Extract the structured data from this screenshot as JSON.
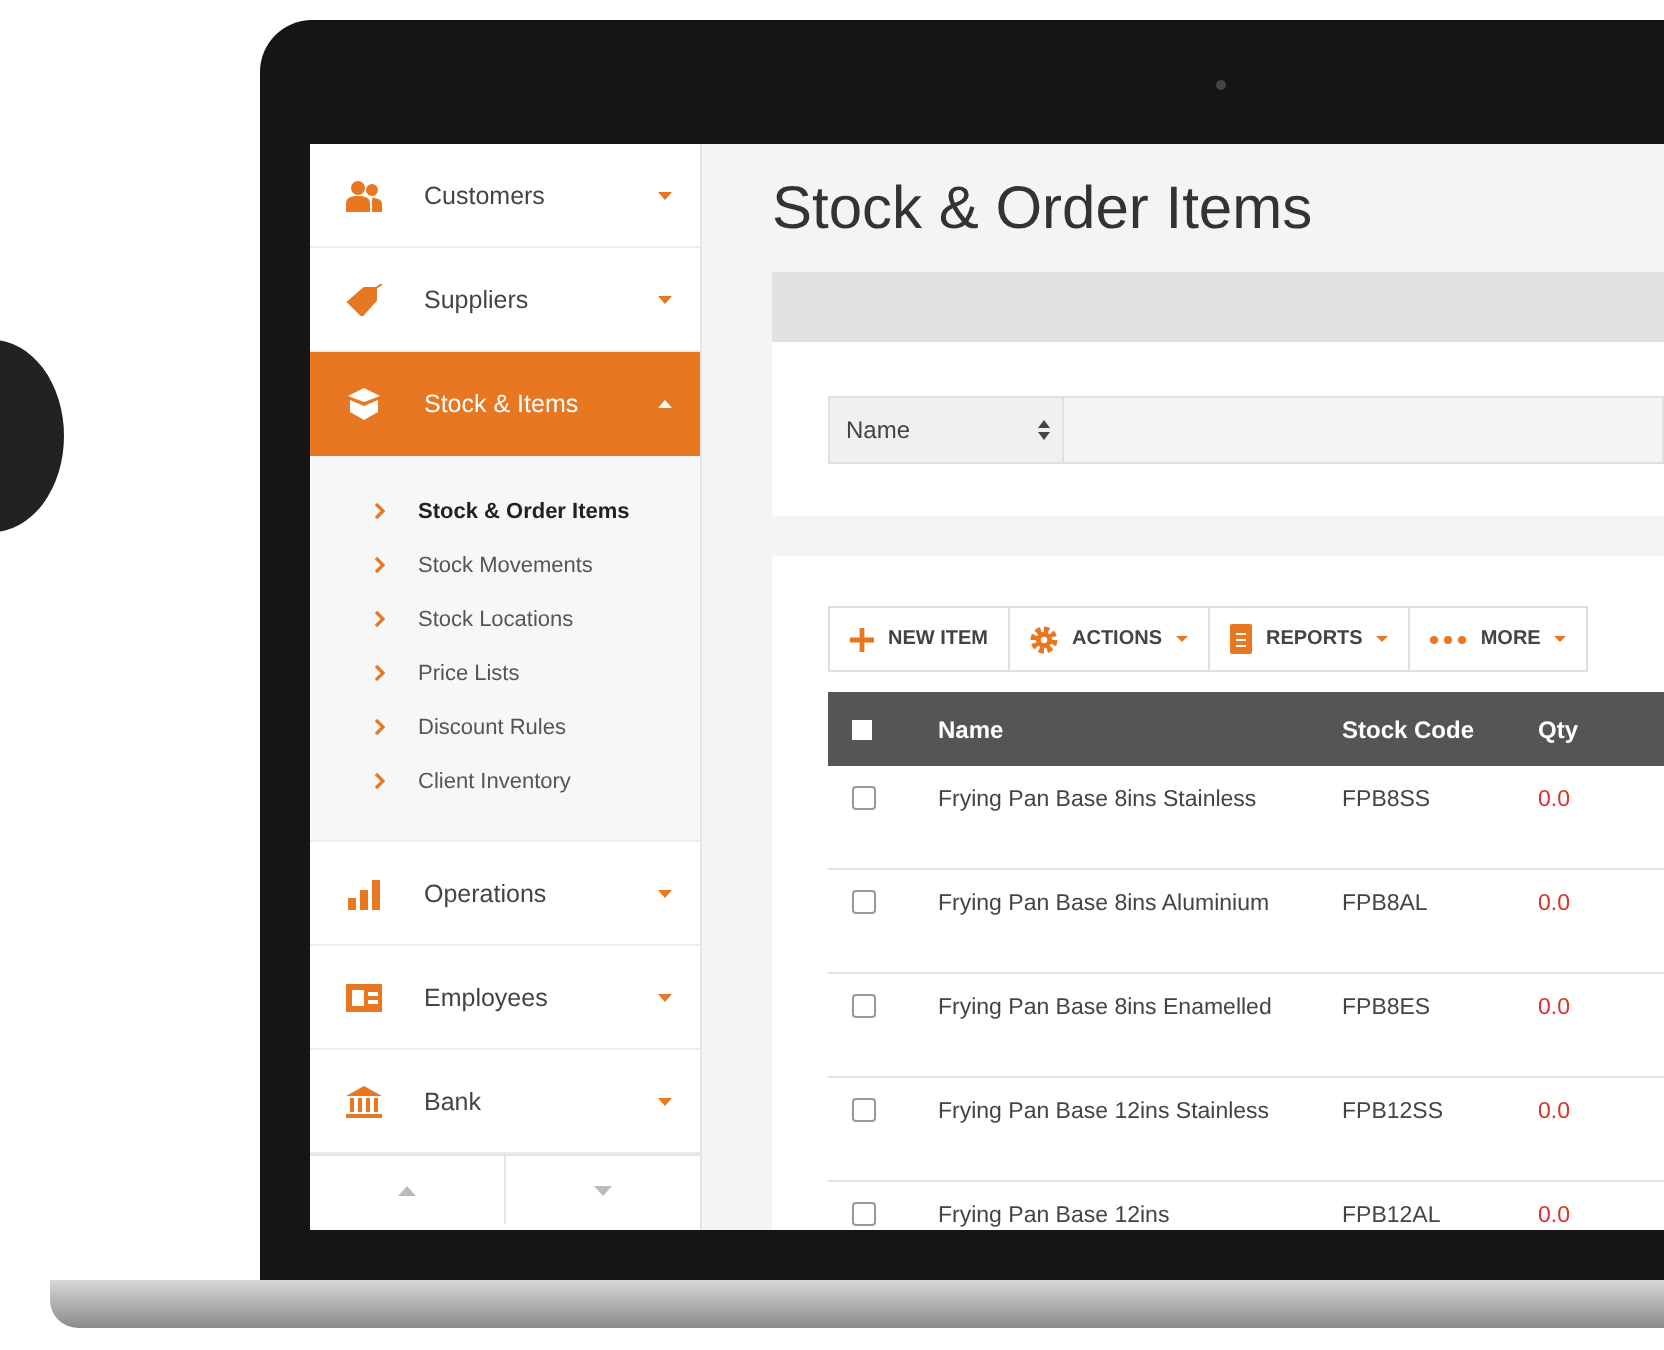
{
  "sidebar": {
    "items": [
      {
        "label": "Customers",
        "selected": false,
        "expanded": false
      },
      {
        "label": "Suppliers",
        "selected": false,
        "expanded": false
      },
      {
        "label": "Stock & Items",
        "selected": true,
        "expanded": true,
        "children": [
          {
            "label": "Stock & Order Items",
            "selected": true
          },
          {
            "label": "Stock Movements",
            "selected": false
          },
          {
            "label": "Stock Locations",
            "selected": false
          },
          {
            "label": "Price Lists",
            "selected": false
          },
          {
            "label": "Discount Rules",
            "selected": false
          },
          {
            "label": "Client Inventory",
            "selected": false
          }
        ]
      },
      {
        "label": "Operations",
        "selected": false,
        "expanded": false
      },
      {
        "label": "Employees",
        "selected": false,
        "expanded": false
      },
      {
        "label": "Bank",
        "selected": false,
        "expanded": false
      }
    ]
  },
  "page": {
    "title": "Stock & Order Items"
  },
  "filter": {
    "field": "Name"
  },
  "toolbar": [
    {
      "label": "NEW ITEM",
      "dropdown": false
    },
    {
      "label": "ACTIONS",
      "dropdown": true
    },
    {
      "label": "REPORTS",
      "dropdown": true
    },
    {
      "label": "MORE",
      "dropdown": true
    }
  ],
  "table": {
    "select_all_checked": false,
    "columns": [
      "Name",
      "Stock Code",
      "Qty"
    ],
    "rows": [
      {
        "name": "Frying Pan Base 8ins Stainless",
        "stock_code": "FPB8SS",
        "qty": "0.0",
        "checked": false
      },
      {
        "name": "Frying Pan Base 8ins Aluminium",
        "stock_code": "FPB8AL",
        "qty": "0.0",
        "checked": false
      },
      {
        "name": "Frying Pan Base 8ins Enamelled",
        "stock_code": "FPB8ES",
        "qty": "0.0",
        "checked": false
      },
      {
        "name": "Frying Pan Base 12ins Stainless",
        "stock_code": "FPB12SS",
        "qty": "0.0",
        "checked": false
      },
      {
        "name": "Frying Pan Base 12ins",
        "stock_code": "FPB12AL",
        "qty": "0.0",
        "checked": false
      }
    ]
  }
}
